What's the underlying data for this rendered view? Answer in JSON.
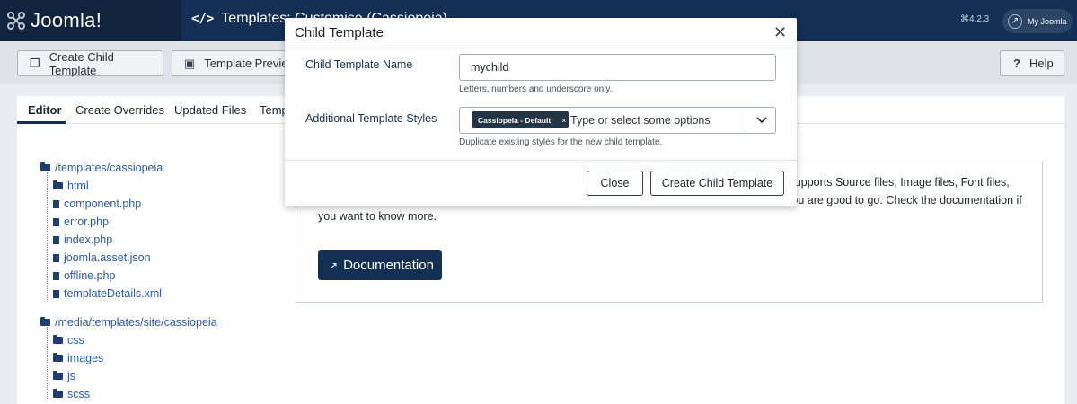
{
  "header": {
    "logo_text": "Joomla!",
    "title": "Templates: Customise (Cassiopeia)",
    "version": "⌘4.2.3",
    "my_joomla": "My Joomla"
  },
  "toolbar": {
    "create_child": "Create Child Template",
    "template_preview": "Template Preview",
    "help": "Help"
  },
  "tabs": [
    "Editor",
    "Create Overrides",
    "Updated Files",
    "Templ"
  ],
  "tree": {
    "root1": "/templates/cassiopeia",
    "root1_items": [
      "html",
      "component.php",
      "error.php",
      "index.php",
      "joomla.asset.json",
      "offline.php",
      "templateDetails.xml"
    ],
    "root2": "/media/templates/site/cassiopeia",
    "root2_items": [
      "css",
      "images",
      "js",
      "scss"
    ]
  },
  "info": {
    "text_tail": "ger supports Source files, Image files, Font files,",
    "text_body": "Zip archives and most of the operations that can be performed on those files. Select a file and you are good to go. Check the documentation if you want to know more.",
    "doc_button": "Documentation"
  },
  "modal": {
    "title": "Child Template",
    "name_label": "Child Template Name",
    "name_value": "mychild",
    "name_hint": "Letters, numbers and underscore only.",
    "styles_label": "Additional Template Styles",
    "chip": "Cassiopeia - Default",
    "chip_remove": "×",
    "styles_placeholder": "Type or select some options",
    "styles_hint": "Duplicate existing styles for the new child template.",
    "close_button": "Close",
    "create_button": "Create Child Template"
  }
}
